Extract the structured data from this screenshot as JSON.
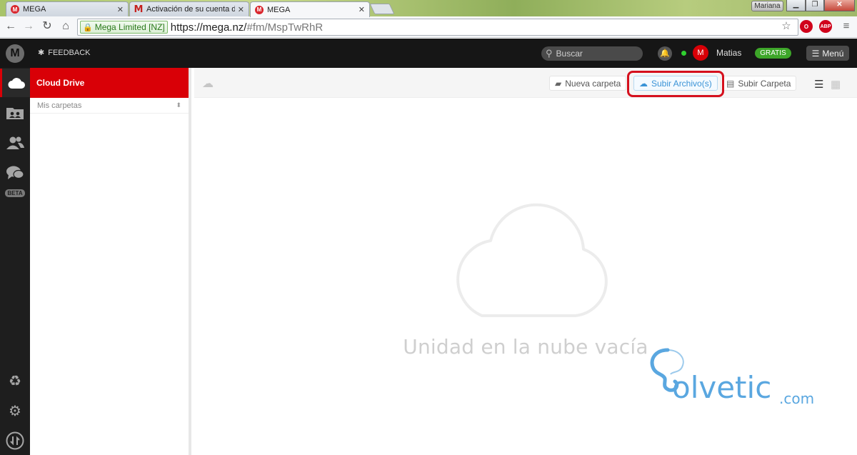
{
  "browser": {
    "tabs": [
      {
        "title": "MEGA",
        "favicon": "mega",
        "active": false
      },
      {
        "title": "Activación de su cuenta d",
        "favicon": "gmail",
        "active": false
      },
      {
        "title": "MEGA",
        "favicon": "mega",
        "active": true
      }
    ],
    "profile_name": "Mariana",
    "address": {
      "site_identity": "Mega Limited [NZ]",
      "url_host": "https://mega.nz/",
      "url_path": "#fm/MspTwRhR"
    },
    "extensions": [
      {
        "name": "opera-extension",
        "color": "#d0021b"
      },
      {
        "name": "adblock-plus",
        "label": "ABP",
        "color": "#d0021b"
      }
    ]
  },
  "header": {
    "logo_letter": "M",
    "feedback_label": "FEEDBACK",
    "search_placeholder": "Buscar",
    "avatar_letter": "M",
    "username": "Matias",
    "plan_badge": "GRATIS",
    "menu_label": "Menú"
  },
  "rail": {
    "beta_label": "BETA",
    "items": [
      "cloud-drive",
      "shared-folders",
      "contacts",
      "chat",
      "rubbish-bin",
      "settings",
      "transfers"
    ]
  },
  "tree": {
    "title": "Cloud Drive",
    "section": "Mis carpetas"
  },
  "toolbar": {
    "new_folder": "Nueva carpeta",
    "upload_files": "Subir Archivo(s)",
    "upload_folder": "Subir Carpeta"
  },
  "main": {
    "empty_message": "Unidad en la nube vacía"
  },
  "watermark": {
    "text": "olvetic",
    "suffix": ".com"
  },
  "colors": {
    "mega_red": "#d90007",
    "highlight": "#d5101d",
    "plan_green": "#3da629",
    "upload_blue": "#3a93d6"
  }
}
